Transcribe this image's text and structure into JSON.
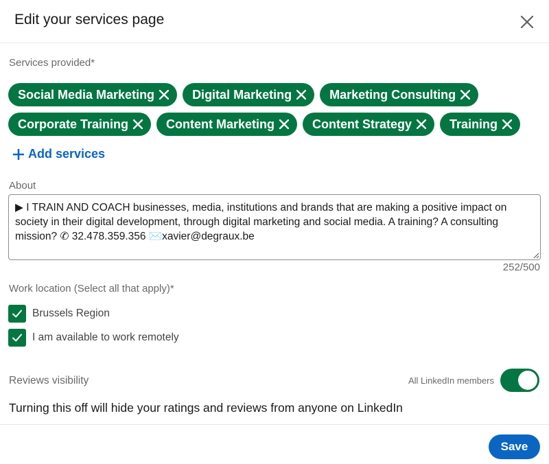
{
  "header": {
    "title": "Edit your services page",
    "close_icon": "close-icon"
  },
  "services": {
    "label": "Services provided*",
    "row1": [
      "Social Media Marketing",
      "Digital Marketing",
      "Marketing Consulting"
    ],
    "row2": [
      "Corporate Training",
      "Content Marketing",
      "Content Strategy",
      "Training"
    ],
    "add_label": "Add services"
  },
  "about": {
    "label": "About",
    "value": "▶ I TRAIN AND COACH businesses, media, institutions and brands that are making a positive impact on society in their digital development, through digital marketing and social media. A training? A consulting mission? ✆ 32.478.359.356 ✉️xavier@degraux.be",
    "char_count": "252/500"
  },
  "work_location": {
    "label": "Work location (Select all that apply)*",
    "options": [
      {
        "label": "Brussels Region",
        "checked": true
      },
      {
        "label": "I am available to work remotely",
        "checked": true
      }
    ]
  },
  "reviews": {
    "label": "Reviews visibility",
    "toggle_label": "All LinkedIn members",
    "toggle_on": true,
    "help_text": "Turning this off will hide your ratings and reviews from anyone on LinkedIn"
  },
  "footer": {
    "save_label": "Save"
  },
  "colors": {
    "accent_green": "#057642",
    "primary_blue": "#0a66c2"
  }
}
